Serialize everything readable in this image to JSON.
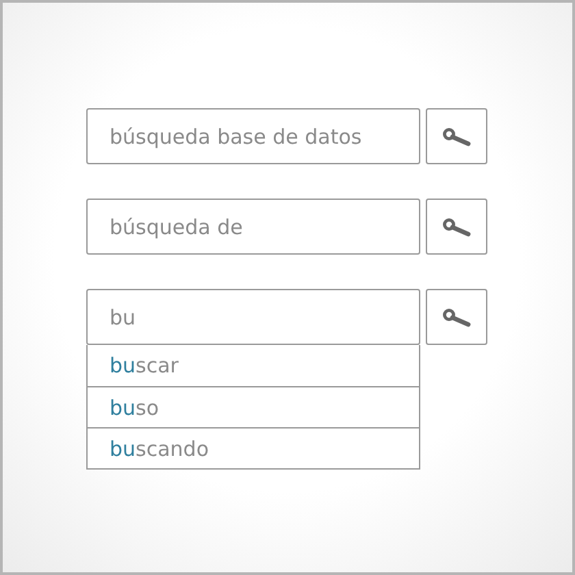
{
  "searches": [
    {
      "value": "búsqueda base de datos"
    },
    {
      "value": "búsqueda de"
    },
    {
      "value": "bu",
      "suggestions": [
        {
          "match": "bu",
          "rest": "scar"
        },
        {
          "match": "bu",
          "rest": "so"
        },
        {
          "match": "bu",
          "rest": "scando"
        }
      ]
    }
  ]
}
